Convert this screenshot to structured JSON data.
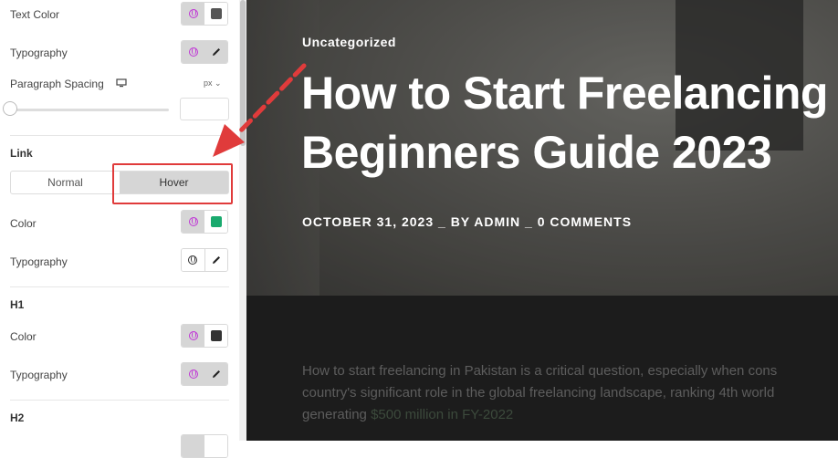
{
  "panel": {
    "text_color_label": "Text Color",
    "typography_label_1": "Typography",
    "paragraph_spacing_label": "Paragraph Spacing",
    "unit": "px ⌄",
    "link_section": "Link",
    "tab_normal": "Normal",
    "tab_hover": "Hover",
    "link_color_label": "Color",
    "link_typography_label": "Typography",
    "h1_section": "H1",
    "h1_color_label": "Color",
    "h1_typography_label": "Typography",
    "h2_section": "H2",
    "collapse_glyph": "‹"
  },
  "hero": {
    "category": "Uncategorized",
    "title_line1": "How to Start Freelancing",
    "title_line2": "Beginners Guide 2023",
    "meta": "OCTOBER 31, 2023 _ BY ADMIN _ 0 COMMENTS"
  },
  "article": {
    "line1": "How to start freelancing in Pakistan is a critical question, especially when cons",
    "line2": "country's significant role in the global freelancing landscape, ranking 4th world",
    "line3_prefix": "generating ",
    "line3_link": "$500 million in FY-2022"
  },
  "colors": {
    "text_swatch": "#555555",
    "link_swatch": "#1aaa6e",
    "h1_swatch": "#333333",
    "highlight": "#e03b3b"
  }
}
